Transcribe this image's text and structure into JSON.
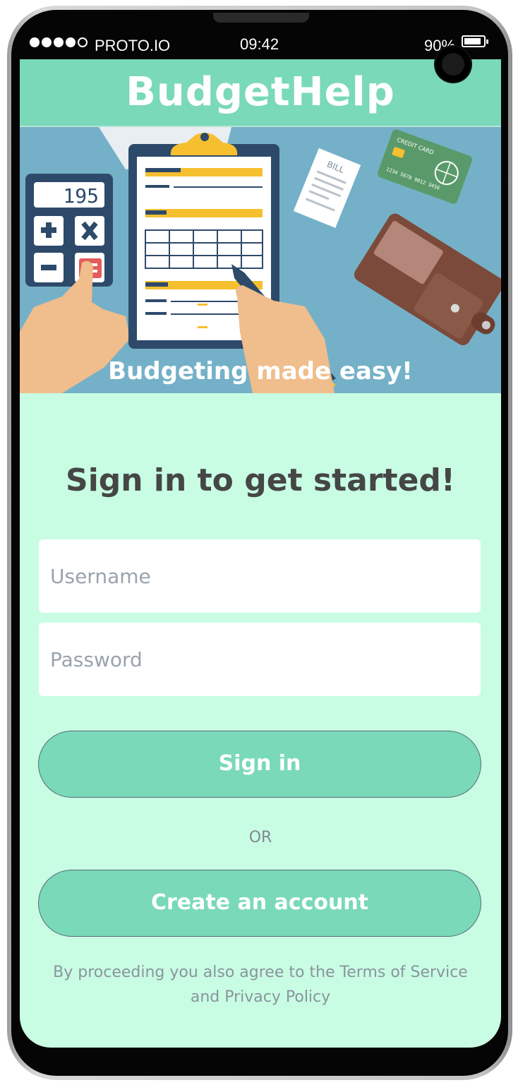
{
  "status_bar": {
    "carrier": "PROTO.IO",
    "time": "09:42",
    "battery_percent": "90%",
    "battery_level": 0.9
  },
  "app": {
    "title": "BudgetHelp"
  },
  "hero": {
    "caption": "Budgeting made easy!",
    "calculator_display": "195",
    "bill_label": "BILL",
    "card_label": "CREDIT CARD",
    "card_number": "1234 5678 9012 3456"
  },
  "signin": {
    "heading": "Sign in to get started!",
    "username_placeholder": "Username",
    "password_placeholder": "Password",
    "signin_label": "Sign in",
    "or_label": "OR",
    "create_label": "Create an account",
    "terms_text": "By proceeding you also agree to the Terms of Service and Privacy Policy"
  },
  "colors": {
    "header": "#79d9b9",
    "screen_bg": "#c8fde3",
    "hero_bg": "#74b1c8",
    "button": "#79d9b9",
    "heading_text": "#464646"
  }
}
